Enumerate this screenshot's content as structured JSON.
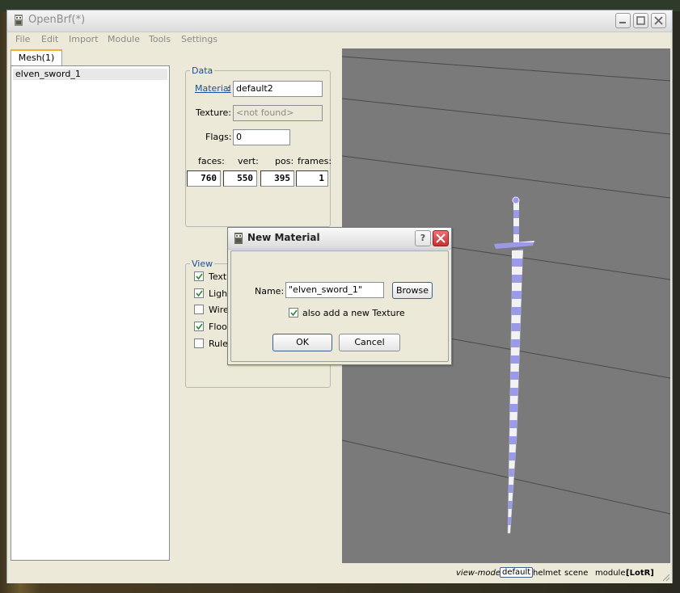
{
  "window": {
    "title": "OpenBrf(*)"
  },
  "menu": [
    "File",
    "Edit",
    "Import",
    "Module",
    "Tools",
    "Settings"
  ],
  "tab": {
    "label": "Mesh(1)"
  },
  "mesh_list": [
    "elven_sword_1"
  ],
  "data_group": {
    "title": "Data",
    "material_label": "Material",
    "material_colon": ":",
    "material_value": "default2",
    "texture_label": "Texture:",
    "texture_value": "<not found>",
    "flags_label": "Flags:",
    "flags_value": "0",
    "faces_label": "faces:",
    "vert_label": "vert:",
    "pos_label": "pos:",
    "frames_label": "frames:",
    "faces_value": "760",
    "vert_value": "550",
    "pos_value": "395",
    "frames_value": "1"
  },
  "view_group": {
    "title": "View",
    "items": [
      {
        "label": "Textu",
        "checked": true
      },
      {
        "label": "Light",
        "checked": true
      },
      {
        "label": "Wire",
        "checked": false
      },
      {
        "label": "Floor",
        "checked": true
      },
      {
        "label": "Ruler",
        "checked": false
      }
    ]
  },
  "dialog": {
    "title": "New Material",
    "help_label": "?",
    "name_label": "Name:",
    "name_value": "\"elven_sword_1\"",
    "browse_label": "Browse",
    "checkbox_label": "also add a new Texture",
    "checkbox_checked": true,
    "ok_label": "OK",
    "cancel_label": "Cancel"
  },
  "status": {
    "view_mode_label": "view-mode:",
    "modes": [
      "default",
      "helmet",
      "scene"
    ],
    "module_label": "module:",
    "module_value": "[LotR]"
  },
  "colors": {
    "accent_link": "#1a4fa0",
    "close_red": "#d04040",
    "viewport_bg": "#7a7a7a",
    "sword_blue": "#9a9ae8"
  }
}
